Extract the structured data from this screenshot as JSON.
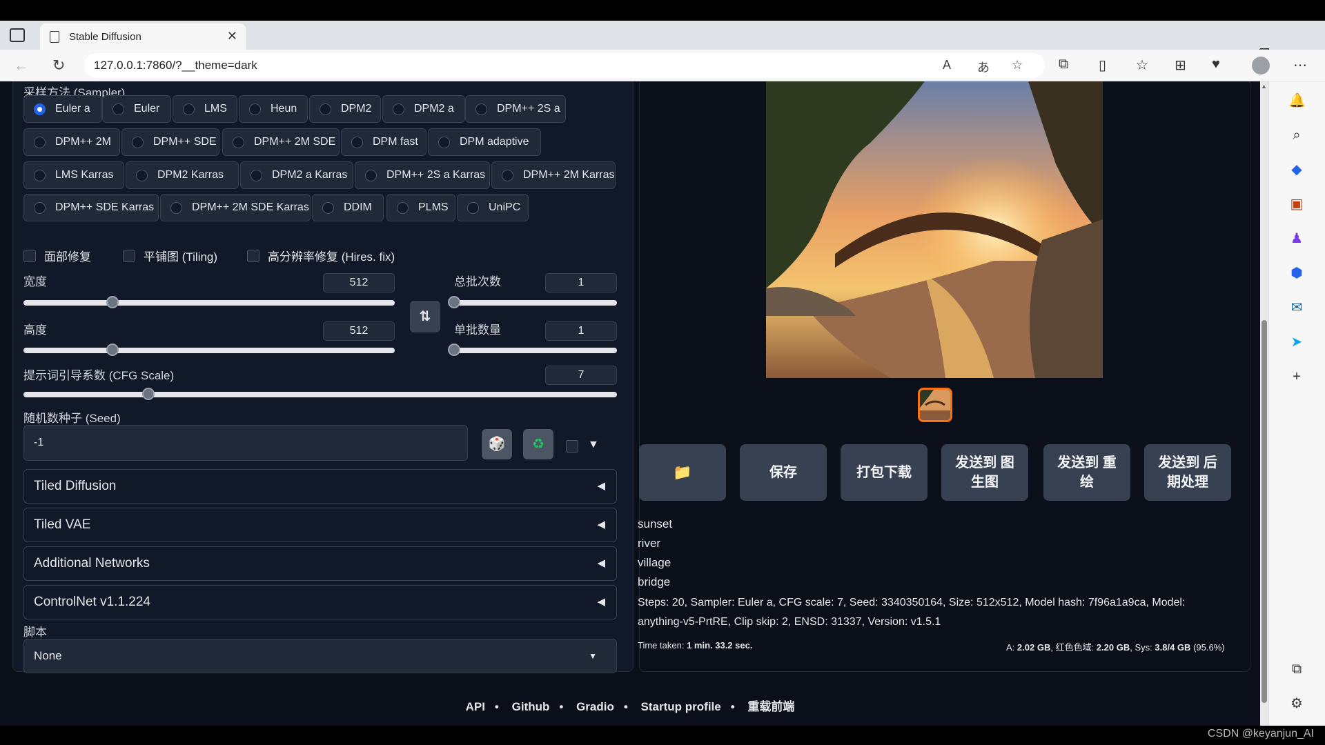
{
  "browser": {
    "tab_title": "Stable Diffusion",
    "url": "127.0.0.1:7860/?__theme=dark"
  },
  "sampler": {
    "label": "采样方法 (Sampler)",
    "options": [
      "Euler a",
      "Euler",
      "LMS",
      "Heun",
      "DPM2",
      "DPM2 a",
      "DPM++ 2S a",
      "DPM++ 2M",
      "DPM++ SDE",
      "DPM++ 2M SDE",
      "DPM fast",
      "DPM adaptive",
      "LMS Karras",
      "DPM2 Karras",
      "DPM2 a Karras",
      "DPM++ 2S a Karras",
      "DPM++ 2M Karras",
      "DPM++ SDE Karras",
      "DPM++ 2M SDE Karras",
      "DDIM",
      "PLMS",
      "UniPC"
    ],
    "selected": "Euler a"
  },
  "checks": {
    "face_restore": "面部修复",
    "tiling": "平铺图 (Tiling)",
    "hires": "高分辨率修复 (Hires. fix)"
  },
  "width": {
    "label": "宽度",
    "value": "512",
    "fraction": 0.24
  },
  "height": {
    "label": "高度",
    "value": "512",
    "fraction": 0.24
  },
  "batch_count": {
    "label": "总批次数",
    "value": "1",
    "fraction": 0.0
  },
  "batch_size": {
    "label": "单批数量",
    "value": "1",
    "fraction": 0.0
  },
  "cfg": {
    "label": "提示词引导系数 (CFG Scale)",
    "value": "7",
    "fraction": 0.21
  },
  "seed": {
    "label": "随机数种子 (Seed)",
    "value": "-1",
    "toggle_glyph": "▼"
  },
  "accordions": [
    "Tiled Diffusion",
    "Tiled VAE",
    "Additional Networks",
    "ControlNet v1.1.224"
  ],
  "script": {
    "label": "脚本",
    "value": "None"
  },
  "actions": {
    "folder_icon": "folder-icon",
    "save": "保存",
    "zip": "打包下载",
    "to_img2img": "发送到 图生图",
    "to_inpaint": "发送到 重绘",
    "to_extras": "发送到 后期处理"
  },
  "prompt_lines": [
    "sunset",
    "river",
    "village",
    "bridge"
  ],
  "gen_info": "Steps: 20, Sampler: Euler a, CFG scale: 7, Seed: 3340350164, Size: 512x512, Model hash: 7f96a1a9ca, Model: anything-v5-PrtRE, Clip skip: 2, ENSD: 31337, Version: v1.5.1",
  "time_taken_label": "Time taken:",
  "time_taken_value": "1 min. 33.2 sec.",
  "vram": {
    "a_label": "A:",
    "a_value": "2.02 GB",
    "r_label": "红色色域:",
    "r_value": "2.20 GB",
    "sys_label": "Sys:",
    "sys_value": "3.8/4 GB",
    "sys_pct": "(95.6%)"
  },
  "footer": [
    "API",
    "Github",
    "Gradio",
    "Startup profile",
    "重载前端"
  ],
  "watermark": "CSDN @keyanjun_AI",
  "colors": {
    "accent": "#2563eb",
    "bg": "#0b0f19",
    "thumb_border": "#f97316"
  }
}
